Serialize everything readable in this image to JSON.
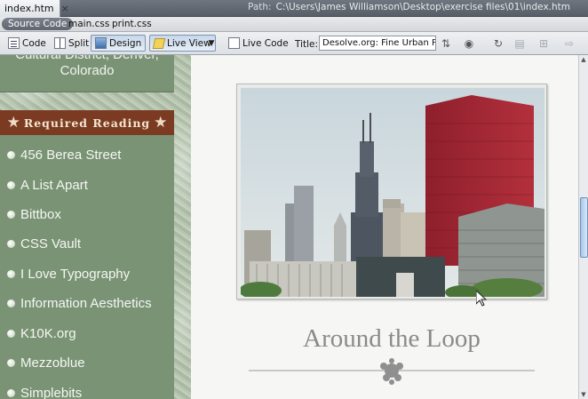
{
  "document_tab": {
    "filename": "index.htm",
    "close_symbol": "×"
  },
  "path": {
    "label": "Path:",
    "value": "C:\\Users\\James Williamson\\Desktop\\exercise files\\01\\index.htm"
  },
  "related_files": [
    "Source Code",
    "main.css",
    "print.css"
  ],
  "toolbar": {
    "code_label": "Code",
    "split_label": "Split",
    "design_label": "Design",
    "live_view_label": "Live View",
    "live_code_label": "Live Code",
    "title_label": "Title:",
    "title_value": "Desolve.org: Fine Urban Photo"
  },
  "sidebar": {
    "location_lines": [
      "Cultural District, Denver,",
      "Colorado"
    ],
    "required_reading_title": "Required Reading",
    "links": [
      "456 Berea Street",
      "A List Apart",
      "Bittbox",
      "CSS Vault",
      "I Love Typography",
      "Information Aesthetics",
      "K10K.org",
      "Mezzoblue",
      "Simplebits"
    ]
  },
  "content": {
    "heading": "Around the Loop"
  },
  "colors": {
    "sidebar_green": "#7a9375",
    "header_brown": "#7b3b22",
    "heading_gray": "#8a8a8a"
  }
}
